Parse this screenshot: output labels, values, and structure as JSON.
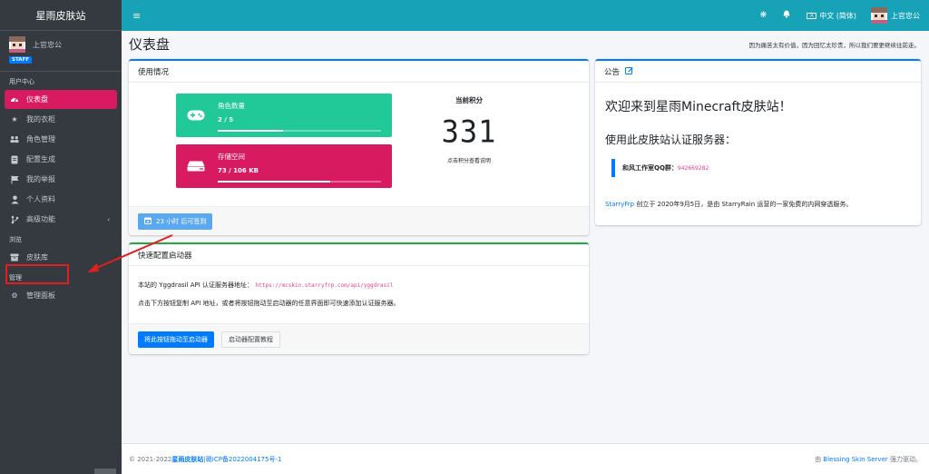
{
  "sidebar": {
    "brand": "星雨皮肤站",
    "user_name": "上官忠公",
    "badge": "STAFF",
    "section_user": "用户中心",
    "items_user": [
      {
        "label": "仪表盘",
        "icon": "dashboard-icon"
      },
      {
        "label": "我的衣柜",
        "icon": "star-icon"
      },
      {
        "label": "角色管理",
        "icon": "users-icon"
      },
      {
        "label": "配置生成",
        "icon": "file-icon"
      },
      {
        "label": "我的举报",
        "icon": "flag-icon"
      },
      {
        "label": "个人资料",
        "icon": "user-icon"
      },
      {
        "label": "高级功能",
        "icon": "branch-icon",
        "caret": "‹"
      }
    ],
    "section_browse": "浏览",
    "items_browse": [
      {
        "label": "皮肤库",
        "icon": "box-icon"
      }
    ],
    "section_admin": "管理",
    "items_admin": [
      {
        "label": "管理面板",
        "icon": "gear-icon"
      }
    ]
  },
  "topbar": {
    "menu_icon": "≡",
    "language": "中文 (简体)",
    "user_name": "上官忠公"
  },
  "header": {
    "title": "仪表盘",
    "motto": "因为痛苦太有价值，因为回忆太珍贵，所以我们要更继续往前走。"
  },
  "usage": {
    "title": "使用情况",
    "roles_label": "角色数量",
    "roles_value": "2 / 5",
    "roles_fraction": 0.4,
    "storage_label": "存储空间",
    "storage_value": "73 / 106 KB",
    "storage_fraction": 0.69,
    "score_title": "当前积分",
    "score_value": "331",
    "score_hint": "点击积分查看说明",
    "signin_button": "23 小时 后可签到"
  },
  "launcher": {
    "title": "快速配置启动器",
    "api_text": "本站的 Yggdrasil API 认证服务器地址：",
    "api_url": "https://mcskin.starryfrp.com/api/yggdrasil",
    "instruction": "点击下方按钮复制 API 地址，或者将按钮拖动至启动器的任意界面即可快速添加认证服务器。",
    "drag_button": "将此按钮拖动至启动器",
    "tutorial_button": "启动器配置教程"
  },
  "notice": {
    "title": "公告",
    "welcome": "欢迎来到星雨Minecraft皮肤站！",
    "subtitle": "使用此皮肤站认证服务器：",
    "qq_label": "和风工作室QQ群：",
    "qq_number": "942669282",
    "link_text": "StarryFrp",
    "body": " 创立于 2020年9月5日，是由 StarryRain 运营的一家免费的内网穿透服务。"
  },
  "footer": {
    "copyright": "© 2021-2022 ",
    "site_name": "星雨皮肤站",
    "separator": " | ",
    "icp": "赣ICP备2022004175号-1",
    "powered_prefix": "由 ",
    "powered_link": "Blessing Skin Server",
    "powered_suffix": " 强力驱动。"
  },
  "colors": {
    "sidebar_bg": "#343a40",
    "topbar_bg": "#17a2b8",
    "active_item": "#d81b60",
    "info_teal": "#20c997",
    "info_pink": "#d81b60",
    "primary": "#007bff",
    "annotation_red": "#e02020"
  }
}
